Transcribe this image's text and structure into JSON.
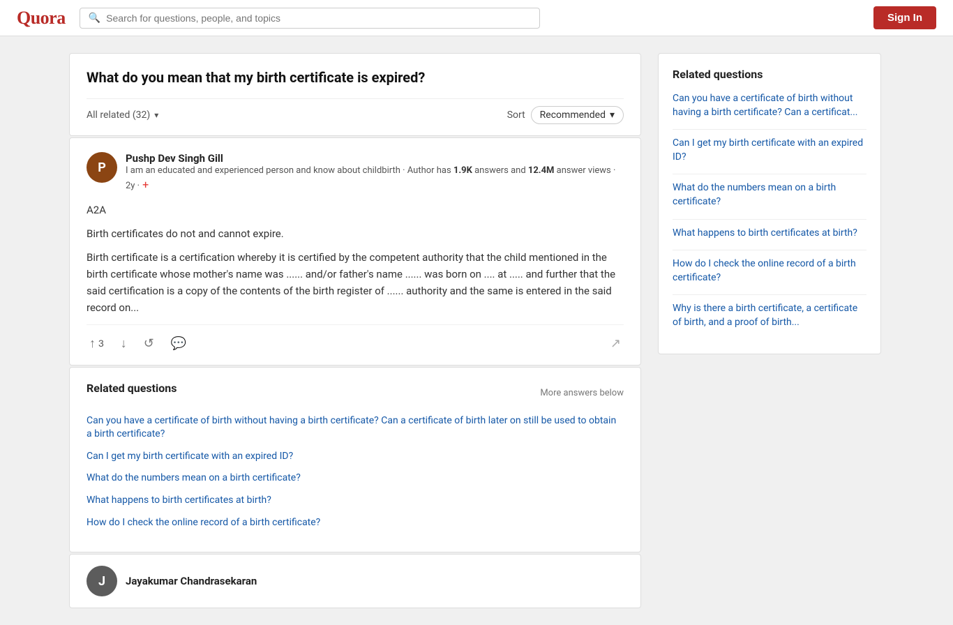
{
  "header": {
    "logo": "Quora",
    "search_placeholder": "Search for questions, people, and topics",
    "sign_in_label": "Sign In"
  },
  "question": {
    "title": "What do you mean that my birth certificate is expired?",
    "filter_label": "All related (32)",
    "sort_label": "Sort",
    "sort_value": "Recommended"
  },
  "answer": {
    "author_name": "Pushp Dev Singh Gill",
    "author_bio_prefix": "I am an educated and experienced person and know about childbirth · Author has ",
    "author_answers": "1.9K",
    "author_bio_mid": " answers and ",
    "author_views": "12.4M",
    "author_bio_suffix": " answer views · 2y ·",
    "a2a": "A2A",
    "para1": "Birth certificates do not and cannot expire.",
    "para2": "Birth certificate is a certification whereby it is certified by the competent authority that the child mentioned in the birth certificate whose mother's name was ...... and/or father's name ...... was born on .... at ..... and further that the said certification is a copy of the contents of the birth register of ...... authority and the same is entered in the said record on...",
    "upvote_count": "3"
  },
  "inline_related": {
    "header": "Related questions",
    "more_answers": "More answers below",
    "links": [
      "Can you have a certificate of birth without having a birth certificate? Can a certificate of birth later on still be used to obtain a birth certificate?",
      "Can I get my birth certificate with an expired ID?",
      "What do the numbers mean on a birth certificate?",
      "What happens to birth certificates at birth?",
      "How do I check the online record of a birth certificate?"
    ]
  },
  "second_answer_author": "Jayakumar Chandrasekaran",
  "sidebar": {
    "title": "Related questions",
    "links": [
      "Can you have a certificate of birth without having a birth certificate? Can a certificat...",
      "Can I get my birth certificate with an expired ID?",
      "What do the numbers mean on a birth certificate?",
      "What happens to birth certificates at birth?",
      "How do I check the online record of a birth certificate?",
      "Why is there a birth certificate, a certificate of birth, and a proof of birth..."
    ]
  },
  "icons": {
    "search": "🔍",
    "chevron_down": "▾",
    "upvote": "↑",
    "downvote": "↓",
    "share": "↗",
    "comment": "💬",
    "refresh": "↺",
    "plus": "+"
  }
}
